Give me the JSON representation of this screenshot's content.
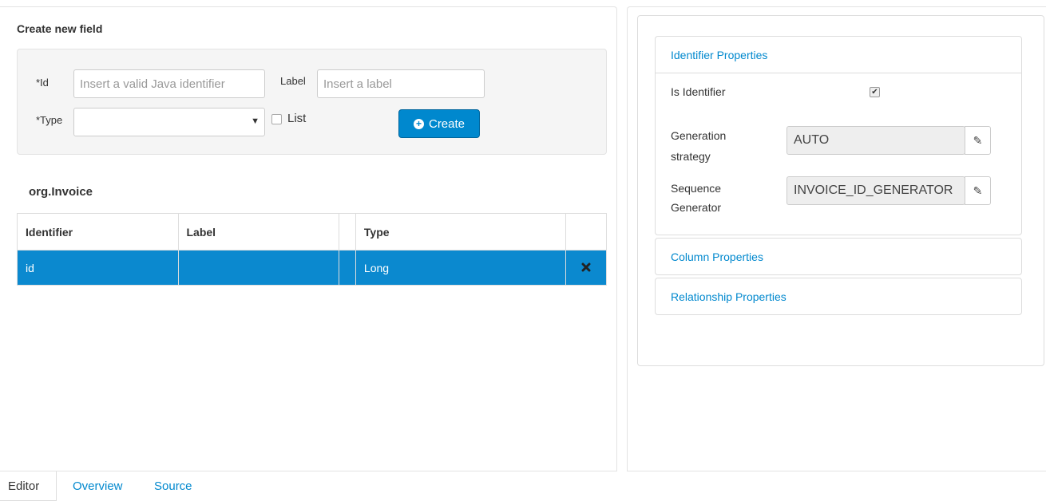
{
  "create_form": {
    "title": "Create new field",
    "id_label": "*Id",
    "id_placeholder": "Insert a valid Java identifier",
    "label_label": "Label",
    "label_placeholder": "Insert a label",
    "type_label": "*Type",
    "type_value": "",
    "list_label": "List",
    "create_button": "Create"
  },
  "entity": {
    "name": "org.Invoice",
    "columns": [
      "Identifier",
      "Label",
      "",
      "Type",
      ""
    ],
    "rows": [
      {
        "identifier": "id",
        "label": "",
        "type": "Long",
        "selected": true
      }
    ]
  },
  "properties": {
    "identifier_section": "Identifier Properties",
    "is_identifier_label": "Is Identifier",
    "is_identifier_checked": true,
    "generation_strategy_label_1": "Generation",
    "generation_strategy_label_2": "strategy",
    "generation_strategy_value": "AUTO",
    "sequence_generator_label_1": "Sequence",
    "sequence_generator_label_2": "Generator",
    "sequence_generator_value": "INVOICE_ID_GENERATOR",
    "column_section": "Column Properties",
    "relationship_section": "Relationship Properties"
  },
  "tabs": [
    "Editor",
    "Overview",
    "Source"
  ],
  "colors": {
    "accent": "#0088ce",
    "selected_row": "#0b89cf"
  }
}
